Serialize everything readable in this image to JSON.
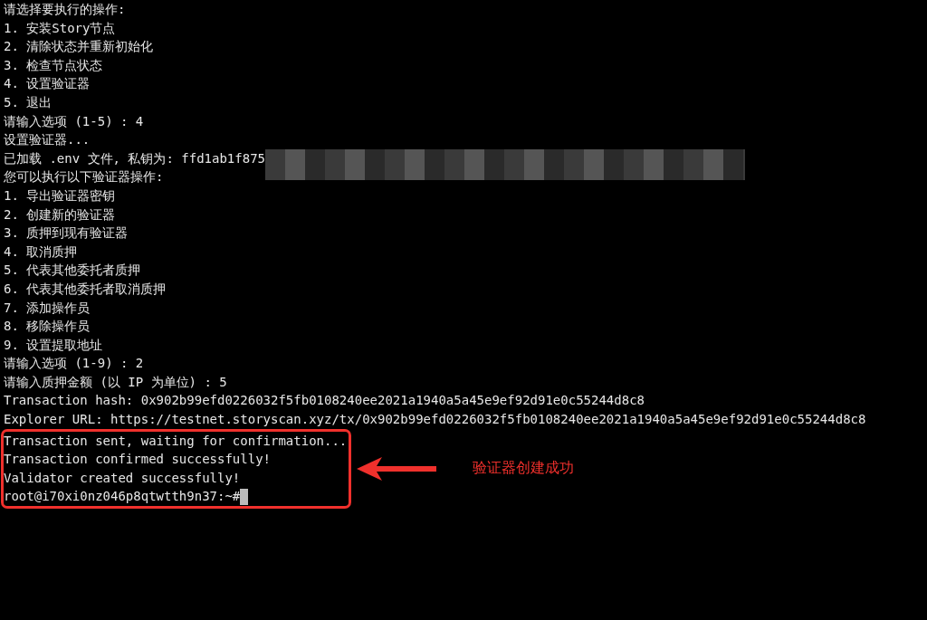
{
  "lines": [
    {
      "kind": "text",
      "text": "请选择要执行的操作:"
    },
    {
      "kind": "text",
      "text": "1. 安装Story节点"
    },
    {
      "kind": "text",
      "text": "2. 清除状态并重新初始化"
    },
    {
      "kind": "text",
      "text": "3. 检查节点状态"
    },
    {
      "kind": "text",
      "text": "4. 设置验证器"
    },
    {
      "kind": "text",
      "text": "5. 退出"
    },
    {
      "kind": "text",
      "text": "请输入选项 (1-5) : 4"
    },
    {
      "kind": "text",
      "text": "设置验证器..."
    },
    {
      "kind": "masked",
      "text": "已加载 .env 文件, 私钥为: ffd1ab1f875"
    },
    {
      "kind": "text",
      "text": "您可以执行以下验证器操作:"
    },
    {
      "kind": "text",
      "text": "1. 导出验证器密钥"
    },
    {
      "kind": "text",
      "text": "2. 创建新的验证器"
    },
    {
      "kind": "text",
      "text": "3. 质押到现有验证器"
    },
    {
      "kind": "text",
      "text": "4. 取消质押"
    },
    {
      "kind": "text",
      "text": "5. 代表其他委托者质押"
    },
    {
      "kind": "text",
      "text": "6. 代表其他委托者取消质押"
    },
    {
      "kind": "text",
      "text": "7. 添加操作员"
    },
    {
      "kind": "text",
      "text": "8. 移除操作员"
    },
    {
      "kind": "text",
      "text": "9. 设置提取地址"
    },
    {
      "kind": "text",
      "text": "请输入选项 (1-9) : 2"
    },
    {
      "kind": "text",
      "text": "请输入质押金额 (以 IP 为单位) : 5"
    },
    {
      "kind": "text",
      "text": "Transaction hash: 0x902b99efd0226032f5fb0108240ee2021a1940a5a45e9ef92d91e0c55244d8c8"
    },
    {
      "kind": "text",
      "text": "Explorer URL: https://testnet.storyscan.xyz/tx/0x902b99efd0226032f5fb0108240ee2021a1940a5a45e9ef92d91e0c55244d8c8"
    }
  ],
  "highlighted_lines": [
    {
      "kind": "text",
      "text": "Transaction sent, waiting for confirmation..."
    },
    {
      "kind": "text",
      "text": "Transaction confirmed successfully!"
    },
    {
      "kind": "text",
      "text": "Validator created successfully!"
    },
    {
      "kind": "prompt",
      "text": "root@i70xi0nz046p8qtwtth9n37:~#"
    }
  ],
  "callout": {
    "text": "验证器创建成功"
  }
}
